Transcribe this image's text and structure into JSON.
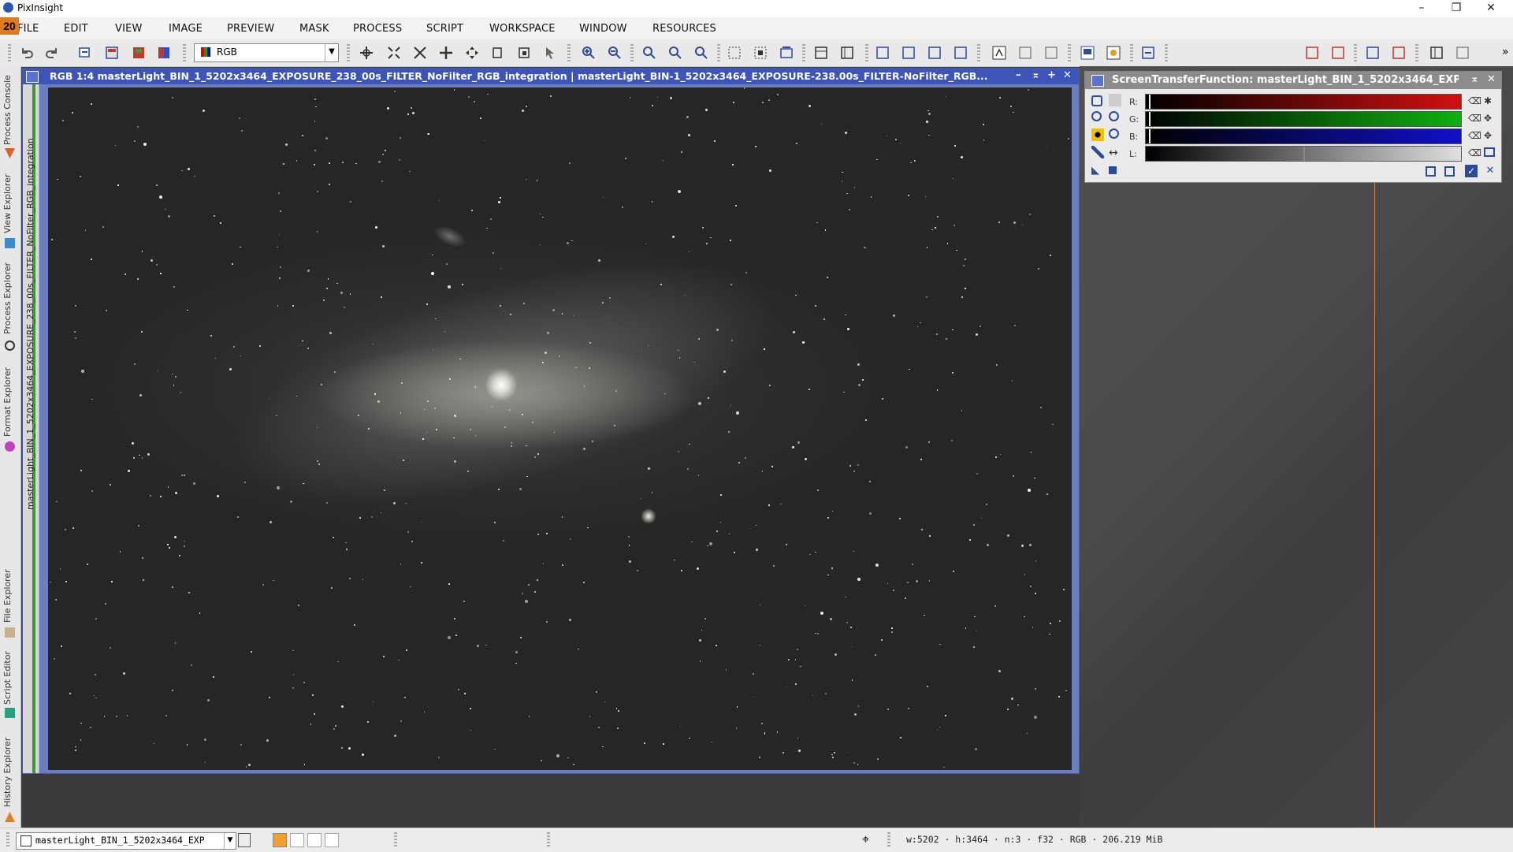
{
  "app": {
    "title": "PixInsight",
    "version_badge": "20"
  },
  "window_controls": {
    "minimize": "–",
    "restore": "❐",
    "close": "✕"
  },
  "menu": [
    "FILE",
    "EDIT",
    "VIEW",
    "IMAGE",
    "PREVIEW",
    "MASK",
    "PROCESS",
    "SCRIPT",
    "WORKSPACE",
    "WINDOW",
    "RESOURCES"
  ],
  "toolbar": {
    "color_mode": "RGB",
    "overflow": "»"
  },
  "left_dock": {
    "tabs": [
      "Process Console",
      "View Explorer",
      "Process Explorer",
      "Format Explorer",
      "File Explorer",
      "Script Editor",
      "History Explorer"
    ]
  },
  "image_window": {
    "title": "RGB 1:4 masterLight_BIN_1_5202x3464_EXPOSURE_238_00s_FILTER_NoFilter_RGB_integration | masterLight_BIN-1_5202x3464_EXPOSURE-238.00s_FILTER-NoFilter_RGB...",
    "view_label": "masterLight_BIN_1_5202x3464_EXPOSURE_238_00s_FILTER_NoFilter_RGB_integration",
    "controls": [
      "–",
      "⌅",
      "+",
      "✕"
    ]
  },
  "stf": {
    "title": "ScreenTransferFunction: masterLight_BIN_1_5202x3464_EXP...",
    "channels": [
      {
        "label": "R:",
        "color": "#d01010"
      },
      {
        "label": "G:",
        "color": "#10b010"
      },
      {
        "label": "B:",
        "color": "#1010c8"
      },
      {
        "label": "L:",
        "color": "#d8d8d8"
      }
    ],
    "close": "✕",
    "pin": "⌅"
  },
  "status_bar": {
    "view_name": "masterLight_BIN_1_5202x3464_EXP",
    "info": "w:5202 · h:3464 · n:3 · f32 · RGB · 206.219 MiB"
  }
}
